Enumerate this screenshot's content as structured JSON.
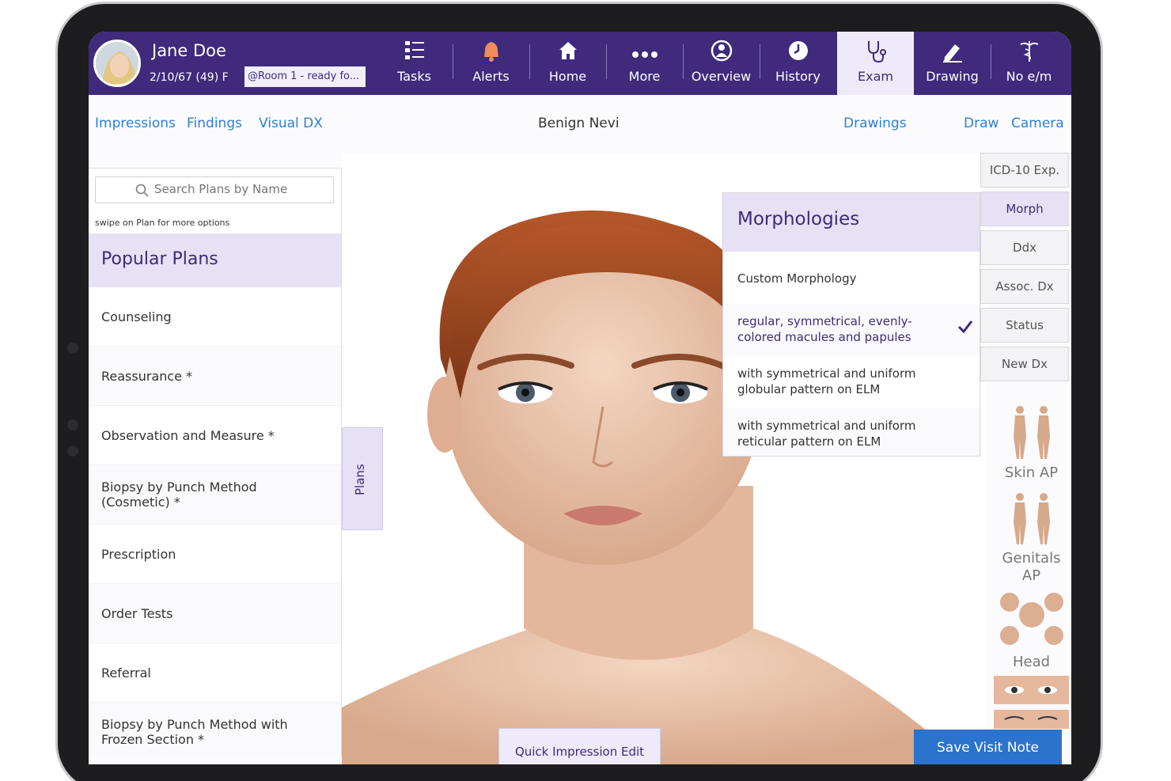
{
  "patient": {
    "name": "Jane Doe",
    "dob_age_sex": "2/10/67 (49) F",
    "room_status": "@Room 1 - ready fo..."
  },
  "nav": {
    "tasks": "Tasks",
    "alerts": "Alerts",
    "home": "Home",
    "more": "More",
    "overview": "Overview",
    "history": "History",
    "exam": "Exam",
    "drawing": "Drawing",
    "no_em": "No e/m",
    "active": "Exam"
  },
  "subbar": {
    "impressions": "Impressions",
    "findings": "Findings",
    "visual_dx": "Visual DX",
    "title": "Benign Nevi",
    "drawings": "Drawings",
    "draw": "Draw",
    "camera": "Camera"
  },
  "plans": {
    "search_placeholder": "Search Plans by Name",
    "swipe_hint": "swipe on Plan for more options",
    "header": "Popular Plans",
    "tab_label": "Plans",
    "items": [
      "Counseling",
      "Reassurance *",
      "Observation and Measure *",
      "Biopsy by Punch Method (Cosmetic) *",
      "Prescription",
      "Order Tests",
      "Referral",
      "Biopsy by Punch Method with Frozen Section *"
    ]
  },
  "morphologies": {
    "header": "Morphologies",
    "items": [
      "Custom Morphology",
      "regular, symmetrical, evenly-colored macules and papules",
      "with symmetrical and uniform globular pattern on ELM",
      "with symmetrical and uniform reticular pattern on ELM"
    ],
    "selected_index": 1
  },
  "side_tabs": {
    "icd10": "ICD-10 Exp.",
    "morph": "Morph",
    "ddx": "Ddx",
    "assoc_dx": "Assoc. Dx",
    "status": "Status",
    "new_dx": "New Dx",
    "active": "Morph"
  },
  "body_thumbs": {
    "skin_ap": "Skin AP",
    "genitals_ap": "Genitals AP",
    "head": "Head"
  },
  "footer": {
    "quick_impression": "Quick Impression Edit",
    "save": "Save Visit Note"
  },
  "colors": {
    "nav_bg": "#3f2a7c",
    "accent_light": "#e6e1f4",
    "link": "#2c7fd6",
    "save_btn": "#2b73cc"
  }
}
